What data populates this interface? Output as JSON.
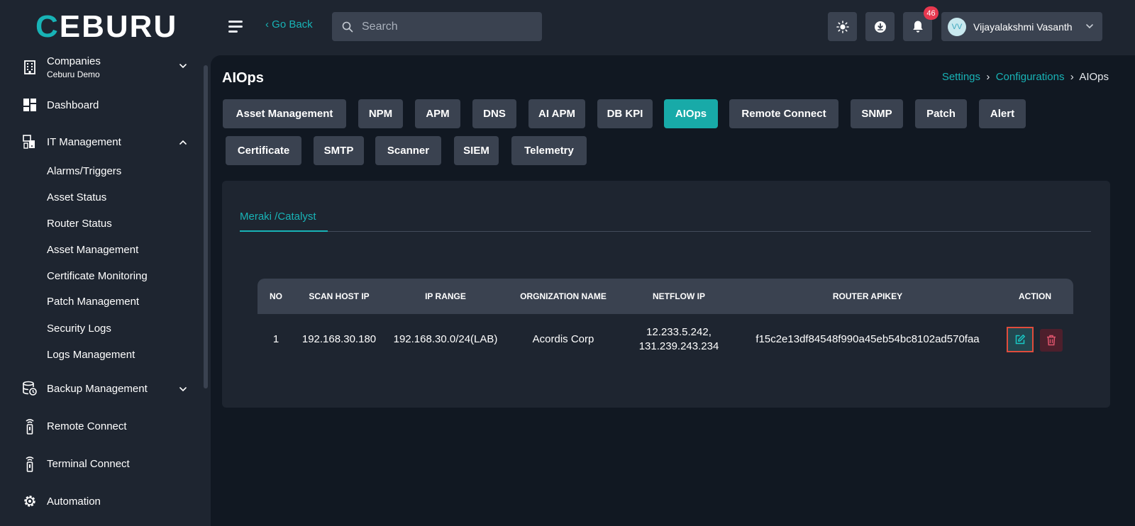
{
  "header": {
    "logo_c": "C",
    "logo_rest": "EBURU",
    "go_back": "‹ Go Back",
    "search_placeholder": "Search",
    "notification_count": "46",
    "user_initials": "VV",
    "user_name": "Vijayalakshmi Vasanth"
  },
  "sidebar": {
    "companies_label": "Companies",
    "companies_value": "Ceburu Demo",
    "dashboard": "Dashboard",
    "it_management": "IT Management",
    "it_sub": [
      "Alarms/Triggers",
      "Asset Status",
      "Router Status",
      "Asset Management",
      "Certificate Monitoring",
      "Patch Management",
      "Security Logs",
      "Logs Management"
    ],
    "backup_management": "Backup Management",
    "remote_connect": "Remote Connect",
    "terminal_connect": "Terminal Connect",
    "automation": "Automation"
  },
  "page": {
    "title": "AIOps",
    "breadcrumb": [
      "Settings",
      "Configurations",
      "AIOps"
    ]
  },
  "tabs_row1": [
    "Asset Management",
    "NPM",
    "APM",
    "DNS",
    "AI APM",
    "DB KPI",
    "AIOps",
    "Remote Connect",
    "SNMP",
    "Patch",
    "Alert"
  ],
  "tabs_row2": [
    "Certificate",
    "SMTP",
    "Scanner",
    "SIEM",
    "Telemetry"
  ],
  "active_tab": "AIOps",
  "subtab": "Meraki /Catalyst",
  "table": {
    "headers": [
      "NO",
      "SCAN HOST IP",
      "IP RANGE",
      "ORGNIZATION NAME",
      "NETFLOW IP",
      "ROUTER APIKEY",
      "ACTION"
    ],
    "rows": [
      {
        "no": "1",
        "scan_host_ip": "192.168.30.180",
        "ip_range": "192.168.30.0/24(LAB)",
        "org_name": "Acordis Corp",
        "netflow_ip_1": "12.233.5.242,",
        "netflow_ip_2": "131.239.243.234",
        "router_apikey": "f15c2e13df84548f990a45eb54bc8102ad570faa"
      }
    ]
  },
  "colors": {
    "accent": "#18b3b6",
    "active_tab": "#18aaa8",
    "badge": "#e8384f",
    "delete": "#e0556d"
  }
}
